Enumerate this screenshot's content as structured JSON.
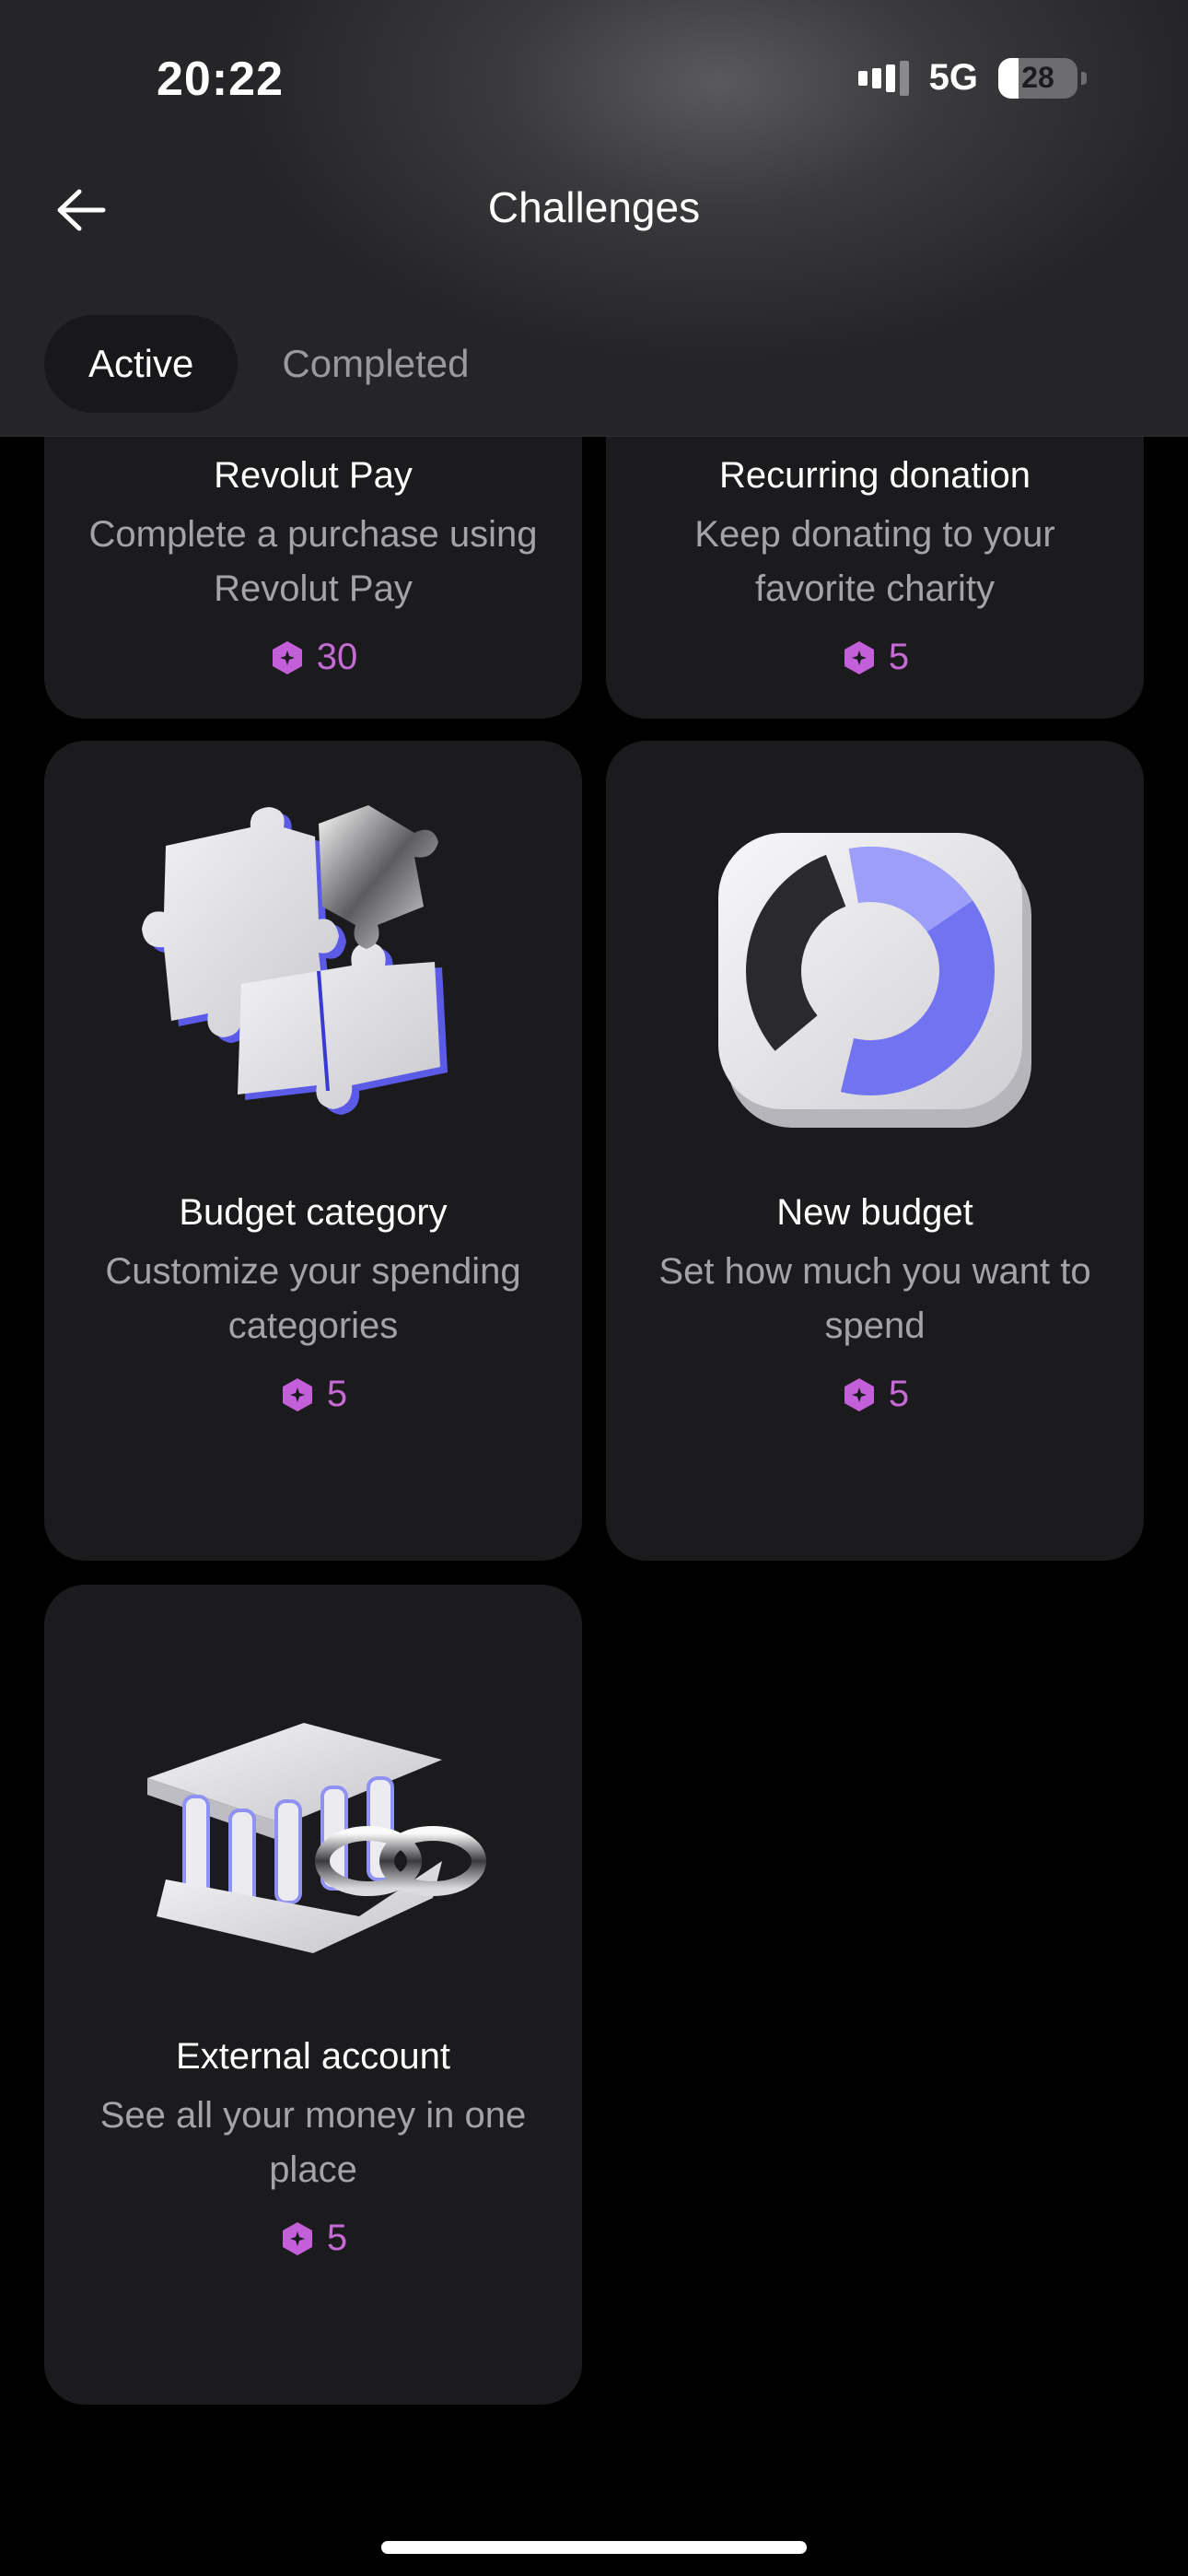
{
  "status_bar": {
    "time": "20:22",
    "network": "5G",
    "battery": "28"
  },
  "header": {
    "title": "Challenges"
  },
  "tabs": [
    {
      "label": "Active",
      "active": true
    },
    {
      "label": "Completed",
      "active": false
    }
  ],
  "reward_color": "#c66ad6",
  "cards": [
    {
      "title": "Revolut Pay",
      "description": "Complete a purchase using Revolut Pay",
      "reward": "30"
    },
    {
      "title": "Recurring donation",
      "description": "Keep donating to your favorite charity",
      "reward": "5"
    },
    {
      "title": "Budget category",
      "description": "Customize your spending categories",
      "reward": "5",
      "icon": "puzzle-pieces-icon"
    },
    {
      "title": "New budget",
      "description": "Set how much you want to spend",
      "reward": "5",
      "icon": "donut-chart-icon"
    },
    {
      "title": "External account",
      "description": "See all your money in one place",
      "reward": "5",
      "icon": "bank-link-icon"
    }
  ]
}
